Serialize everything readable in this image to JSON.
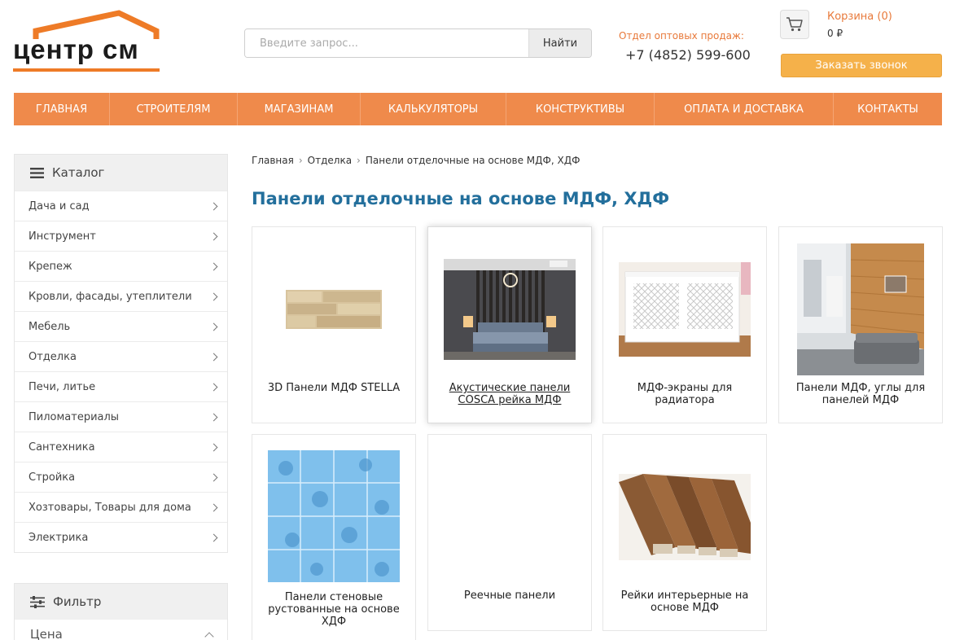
{
  "header": {
    "logo_text": "центр см",
    "search_placeholder": "Введите запрос...",
    "search_button": "Найти",
    "wholesale_label": "Отдел оптовых продаж:",
    "wholesale_phone": "+7 (4852) 599-600",
    "cart_title": "Корзина (0)",
    "cart_sum": "0 ₽",
    "callback_button": "Заказать звонок"
  },
  "nav": [
    {
      "label": "Главная"
    },
    {
      "label": "Строителям"
    },
    {
      "label": "Магазинам"
    },
    {
      "label": "Калькуляторы"
    },
    {
      "label": "Конструктивы"
    },
    {
      "label": "Оплата и доставка"
    },
    {
      "label": "Контакты"
    }
  ],
  "sidebar": {
    "catalog_title": "Каталог",
    "items": [
      {
        "label": "Дача и сад"
      },
      {
        "label": "Инструмент"
      },
      {
        "label": "Крепеж"
      },
      {
        "label": "Кровли, фасады, утеплители"
      },
      {
        "label": "Мебель"
      },
      {
        "label": "Отделка"
      },
      {
        "label": "Печи, литье"
      },
      {
        "label": "Пиломатериалы"
      },
      {
        "label": "Сантехника"
      },
      {
        "label": "Стройка"
      },
      {
        "label": "Хозтовары, Товары для дома"
      },
      {
        "label": "Электрика"
      }
    ],
    "filter_title": "Фильтр",
    "filter_price": "Цена"
  },
  "breadcrumb": [
    "Главная",
    "Отделка",
    "Панели отделочные на основе МДФ, ХДФ"
  ],
  "page_title": "Панели отделочные на основе МДФ, ХДФ",
  "products": [
    {
      "name": "3D Панели МДФ STELLA"
    },
    {
      "name": "Акустические панели COSCA рейка МДФ"
    },
    {
      "name": "МДФ-экраны для радиатора"
    },
    {
      "name": "Панели МДФ, углы для панелей МДФ"
    },
    {
      "name": "Панели стеновые рустованные на основе ХДФ"
    },
    {
      "name": "Реечные панели"
    },
    {
      "name": "Рейки интерьерные на основе МДФ"
    }
  ],
  "colors": {
    "accent": "#ef8a4b",
    "title": "#236f9c",
    "callback": "#f5b14a"
  }
}
